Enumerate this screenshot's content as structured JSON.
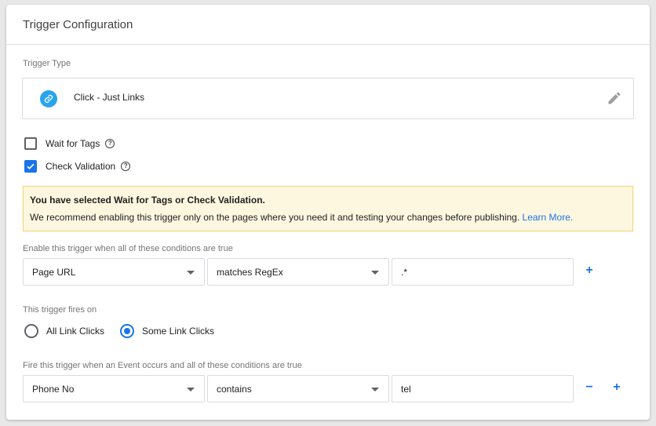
{
  "card": {
    "title": "Trigger Configuration"
  },
  "trigger_type": {
    "section_label": "Trigger Type",
    "name": "Click - Just Links",
    "icon": "link-icon",
    "icon_color": "#29a3ee"
  },
  "options": {
    "wait_for_tags": {
      "label": "Wait for Tags",
      "checked": false
    },
    "check_validation": {
      "label": "Check Validation",
      "checked": true
    },
    "help_glyph": "?"
  },
  "warning": {
    "title": "You have selected Wait for Tags or Check Validation.",
    "body": "We recommend enabling this trigger only on the pages where you need it and testing your changes before publishing.",
    "link": "Learn More."
  },
  "enable_conditions": {
    "label": "Enable this trigger when all of these conditions are true",
    "variable": "Page URL",
    "operator": "matches RegEx",
    "value": ".*",
    "add": "+"
  },
  "fires_on": {
    "label": "This trigger fires on",
    "options": [
      {
        "label": "All Link Clicks",
        "selected": false
      },
      {
        "label": "Some Link Clicks",
        "selected": true
      }
    ]
  },
  "fire_conditions": {
    "label": "Fire this trigger when an Event occurs and all of these conditions are true",
    "variable": "Phone No",
    "operator": "contains",
    "value": "tel",
    "remove": "−",
    "add": "+"
  },
  "colors": {
    "accent": "#1a73e8",
    "warning_bg": "#fef7e0",
    "warning_border": "#f3d36b"
  }
}
